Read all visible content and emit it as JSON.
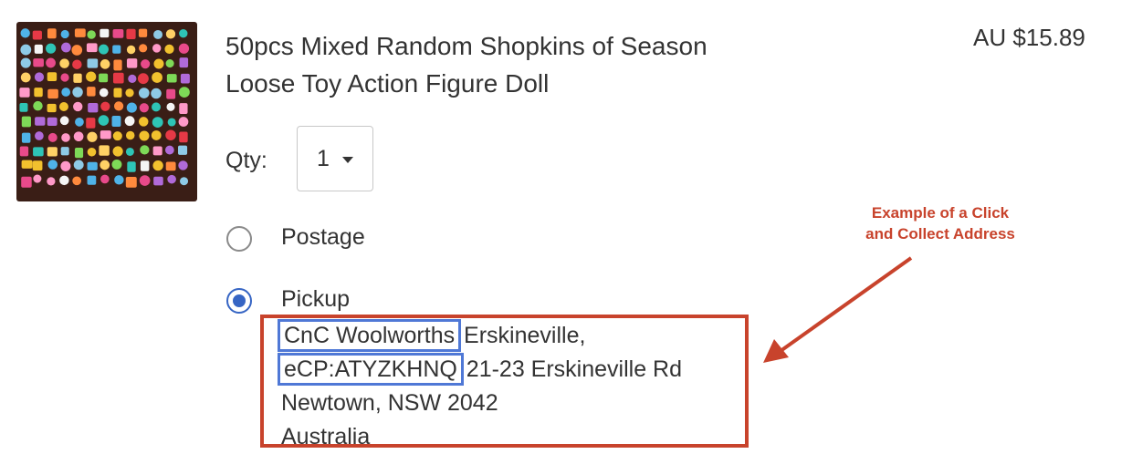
{
  "product": {
    "title_line1": "50pcs Mixed Random Shopkins of Season",
    "title_line2": "Loose Toy Action Figure Doll",
    "price": "AU $15.89",
    "thumbnail_alt": "Assorted Shopkins toys"
  },
  "quantity": {
    "label": "Qty:",
    "selected": "1"
  },
  "delivery": {
    "postage_label": "Postage",
    "pickup_label": "Pickup",
    "selected": "Pickup"
  },
  "address": {
    "store_name": "CnC Woolworths",
    "line1_rest": " Erskineville,",
    "ecp_code": "eCP:ATYZKHNQ",
    "line2_rest": " 21-23 Erskineville Rd",
    "line3": "Newtown, NSW 2042",
    "line4": "Australia"
  },
  "annotation": {
    "text_line1": "Example of a Click",
    "text_line2": "and Collect Address",
    "color": "#c8432c",
    "highlight_color": "#4f78d6"
  }
}
